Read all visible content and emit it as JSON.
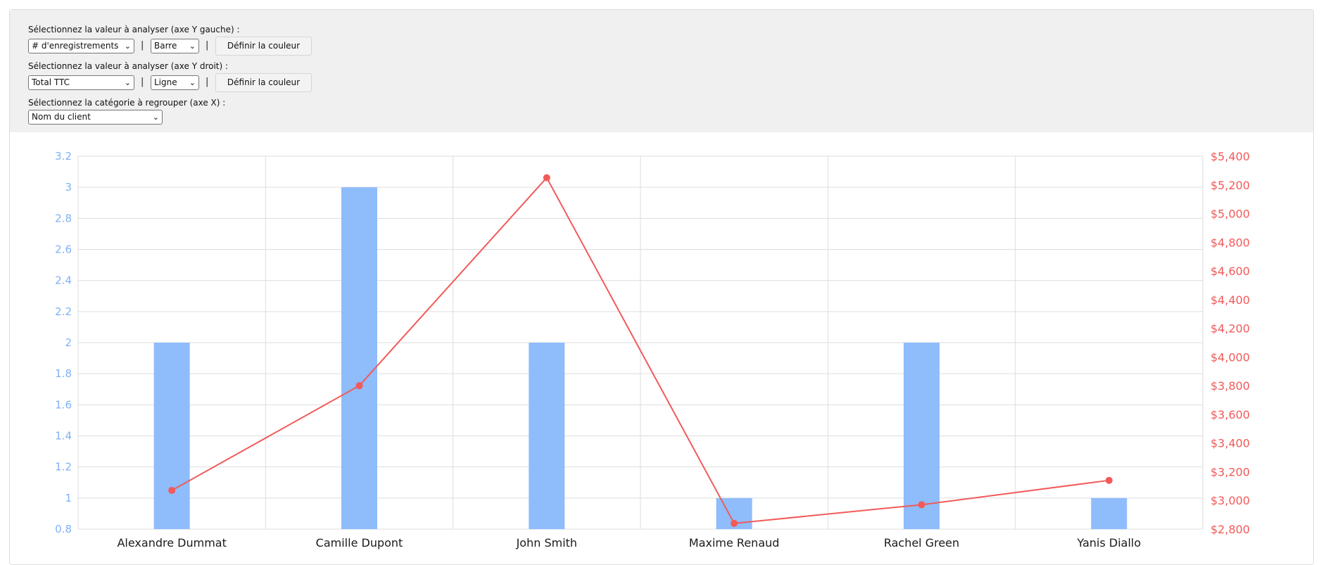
{
  "controls": {
    "left_axis_label": "Sélectionnez la valeur à analyser (axe Y gauche) :",
    "left_value_select": "# d'enregistrements",
    "left_type_select": "Barre",
    "left_color_button": "Définir la couleur",
    "right_axis_label": "Sélectionnez la valeur à analyser (axe Y droit) :",
    "right_value_select": "Total TTC",
    "right_type_select": "Ligne",
    "right_color_button": "Définir la couleur",
    "x_axis_label": "Sélectionnez la catégorie à regrouper (axe X) :",
    "x_category_select": "Nom du client",
    "separator": "|",
    "chevron_icon": "chevron-down-icon"
  },
  "chart_data": {
    "type": "bar",
    "categories": [
      "Alexandre Dummat",
      "Camille Dupont",
      "John Smith",
      "Maxime Renaud",
      "Rachel Green",
      "Yanis Diallo"
    ],
    "series": [
      {
        "type": "bar",
        "axis": "left",
        "color": "#8fbcfb",
        "values": [
          2,
          3,
          2,
          1,
          2,
          1
        ]
      },
      {
        "type": "line",
        "axis": "right",
        "color": "#f25a5a",
        "values": [
          3070,
          3800,
          5250,
          2840,
          2970,
          3140
        ]
      }
    ],
    "y_left": {
      "ylim": [
        0.8,
        3.2
      ],
      "ticks": [
        0.8,
        1,
        1.2,
        1.4,
        1.6,
        1.8,
        2,
        2.2,
        2.4,
        2.6,
        2.8,
        3,
        3.2
      ],
      "tick_labels": [
        "0.8",
        "1",
        "1.2",
        "1.4",
        "1.6",
        "1.8",
        "2",
        "2.2",
        "2.4",
        "2.6",
        "2.8",
        "3",
        "3.2"
      ],
      "color": "#7fb1f5"
    },
    "y_right": {
      "ylim": [
        2800,
        5400
      ],
      "ticks": [
        2800,
        3000,
        3200,
        3400,
        3600,
        3800,
        4000,
        4200,
        4400,
        4600,
        4800,
        5000,
        5200,
        5400
      ],
      "tick_labels": [
        "$2,800",
        "$3,000",
        "$3,200",
        "$3,400",
        "$3,600",
        "$3,800",
        "$4,000",
        "$4,200",
        "$4,400",
        "$4,600",
        "$4,800",
        "$5,000",
        "$5,200",
        "$5,400"
      ],
      "color": "#f25a5a"
    },
    "grid": true,
    "grid_color": "#dddddd",
    "title": "",
    "xlabel": "",
    "ylabel": ""
  }
}
